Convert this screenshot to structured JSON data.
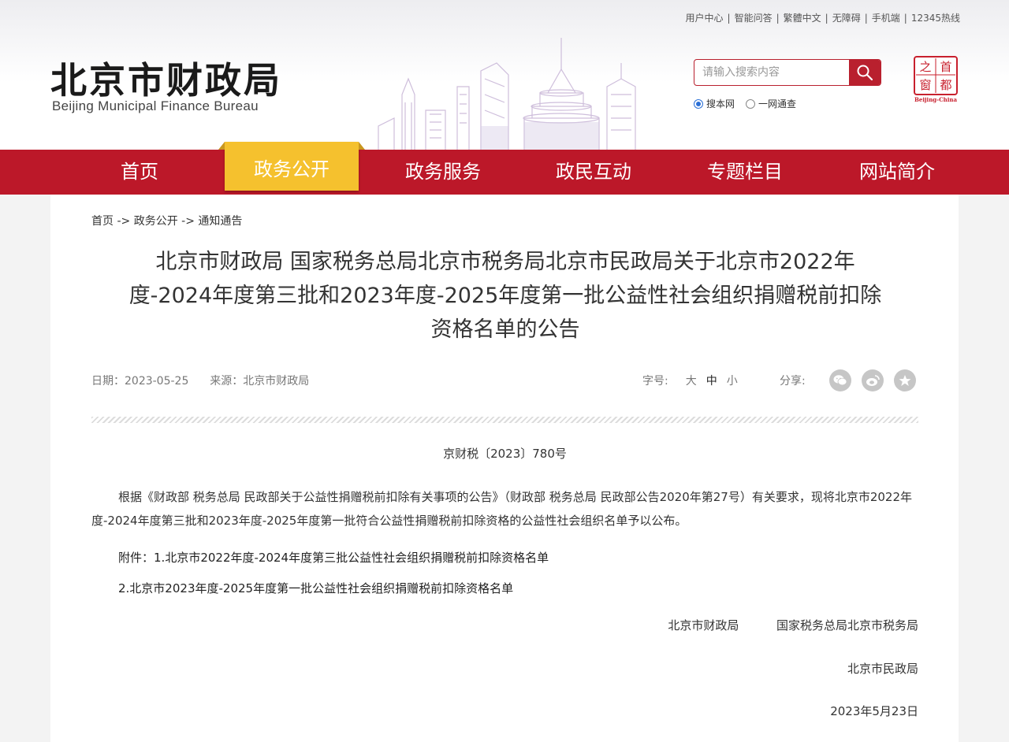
{
  "toplinks": [
    "用户中心",
    "智能问答",
    "繁體中文",
    "无障碍",
    "手机端",
    "12345热线"
  ],
  "logo": {
    "cn": "北京市财政局",
    "en": "Beijing Municipal Finance Bureau"
  },
  "seal": {
    "chars": [
      "首",
      "都",
      "之",
      "窗"
    ],
    "caption": "Beijing-China"
  },
  "search": {
    "placeholder": "请输入搜索内容",
    "scope_site": "搜本网",
    "scope_all": "一网通查"
  },
  "nav": [
    "首页",
    "政务公开",
    "政务服务",
    "政民互动",
    "专题栏目",
    "网站简介"
  ],
  "nav_active": 1,
  "breadcrumb": [
    "首页",
    "政务公开",
    "通知通告"
  ],
  "breadcrumb_sep": "->",
  "article": {
    "title_line1": "北京市财政局 国家税务总局北京市税务局北京市民政局关于北京市2022年",
    "title_line2": "度-2024年度第三批和2023年度-2025年度第一批公益性社会组织捐赠税前扣除",
    "title_line3": "资格名单的公告",
    "date_label": "日期：",
    "date": "2023-05-25",
    "source_label": "来源：",
    "source": "北京市财政局",
    "font_label": "字号:",
    "font_large": "大",
    "font_medium": "中",
    "font_small": "小",
    "share_label": "分享:",
    "doc_no": "京财税〔2023〕780号",
    "body": "根据《财政部 税务总局 民政部关于公益性捐赠税前扣除有关事项的公告》（财政部 税务总局 民政部公告2020年第27号）有关要求，现将北京市2022年度-2024年度第三批和2023年度-2025年度第一批符合公益性捐赠税前扣除资格的公益性社会组织名单予以公布。",
    "attach_label": "附件：",
    "attach1": "1.北京市2022年度-2024年度第三批公益性社会组织捐赠税前扣除资格名单",
    "attach2": "2.北京市2023年度-2025年度第一批公益性社会组织捐赠税前扣除资格名单",
    "sign_org1": "北京市财政局",
    "sign_org2": "国家税务总局北京市税务局",
    "sign_org3": "北京市民政局",
    "sign_date": "2023年5月23日"
  },
  "colors": {
    "nav_red": "#bc1829",
    "nav_active": "#f5c12e",
    "search_red": "#b9202e"
  }
}
